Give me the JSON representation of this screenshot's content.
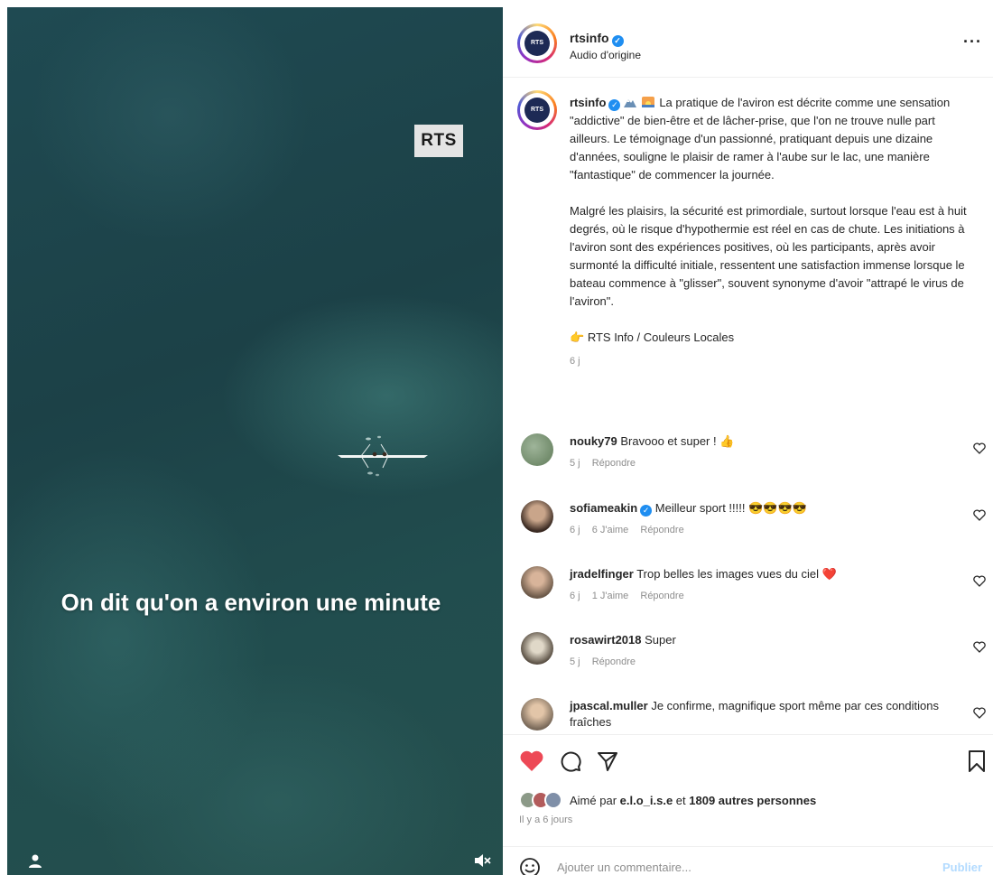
{
  "video": {
    "logo_text": "RTS",
    "caption": "On dit qu'on a environ une minute",
    "icons": [
      "user-icon",
      "mute-icon"
    ]
  },
  "header": {
    "avatar_text": "RTS",
    "username": "rtsinfo",
    "verified": true,
    "audio": "Audio d'origine",
    "more": "···"
  },
  "post_caption": {
    "username": "rtsinfo",
    "emojis": [
      "mountain-emoji",
      "sunrise-emoji"
    ],
    "paragraph1": "La pratique de l'aviron est décrite comme une sensation \"addictive\" de bien-être et de lâcher-prise, que l'on ne trouve nulle part ailleurs. Le témoignage d'un passionné, pratiquant depuis une dizaine d'années, souligne le plaisir de ramer à l'aube sur le lac, une manière \"fantastique\" de commencer la journée.",
    "paragraph2": "Malgré les plaisirs, la sécurité est primordiale, surtout lorsque l'eau est à huit degrés, où le risque d'hypothermie est réel en cas de chute. Les initiations à l'aviron sont des expériences positives, où les participants, après avoir surmonté la difficulté initiale, ressentent une satisfaction immense lorsque le bateau commence à \"glisser\", souvent synonyme d'avoir \"attrapé le virus de l'aviron\".",
    "source": "RTS Info / Couleurs Locales",
    "time": "6 j"
  },
  "comments": [
    {
      "user": "nouky79",
      "text": "Bravooo et super ! 👍",
      "time": "5 j",
      "likes": "",
      "reply": "Répondre"
    },
    {
      "user": "sofiameakin",
      "verified": true,
      "text": "Meilleur sport !!!!! 😎😎😎😎",
      "time": "6 j",
      "likes": "6 J'aime",
      "reply": "Répondre"
    },
    {
      "user": "jradelfinger",
      "text": "Trop belles les images vues du ciel ❤️",
      "time": "6 j",
      "likes": "1 J'aime",
      "reply": "Répondre"
    },
    {
      "user": "rosawirt2018",
      "text": "Super",
      "time": "5 j",
      "likes": "",
      "reply": "Répondre"
    },
    {
      "user": "jpascal.muller",
      "text": "Je confirme, magnifique sport même par ces conditions fraîches",
      "time": "",
      "likes": "",
      "reply": ""
    }
  ],
  "actions": {
    "liked_by_prefix": "Aimé par ",
    "liked_by_user": "e.l.o_i.s.e",
    "liked_by_middle": " et ",
    "liked_by_count": "1809 autres personnes",
    "date": "Il y a 6 jours",
    "comment_placeholder": "Ajouter un commentaire...",
    "publish": "Publier"
  },
  "colors": {
    "like_red": "#ed4956",
    "verified_blue": "#1f8ef1",
    "publish_disabled": "#b3dbff",
    "water": "#1f4a52"
  }
}
